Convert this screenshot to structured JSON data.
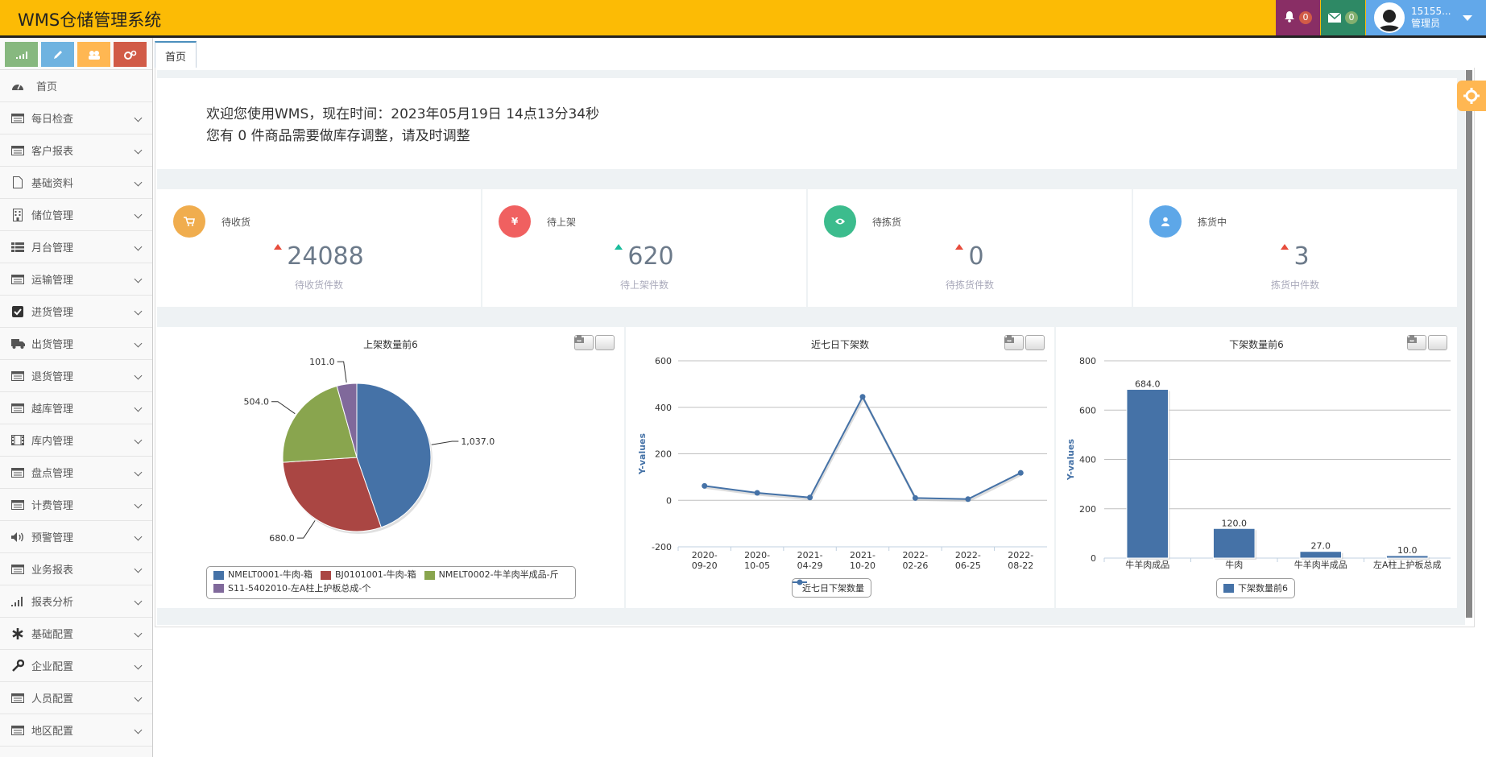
{
  "app": {
    "title": "WMS仓储管理系统"
  },
  "header": {
    "notifications_count": "0",
    "messages_count": "0",
    "user_name": "15155...",
    "user_role": "管理员"
  },
  "sidebar": {
    "home": "首页",
    "items": [
      {
        "label": "每日检查",
        "icon": "list-icon"
      },
      {
        "label": "客户报表",
        "icon": "list-icon"
      },
      {
        "label": "基础资料",
        "icon": "file-icon"
      },
      {
        "label": "储位管理",
        "icon": "building-icon"
      },
      {
        "label": "月台管理",
        "icon": "th-list-icon"
      },
      {
        "label": "运输管理",
        "icon": "list-icon"
      },
      {
        "label": "进货管理",
        "icon": "check-square-icon"
      },
      {
        "label": "出货管理",
        "icon": "truck-icon"
      },
      {
        "label": "退货管理",
        "icon": "list-icon"
      },
      {
        "label": "越库管理",
        "icon": "list-icon"
      },
      {
        "label": "库内管理",
        "icon": "film-icon"
      },
      {
        "label": "盘点管理",
        "icon": "list-icon"
      },
      {
        "label": "计费管理",
        "icon": "list-icon"
      },
      {
        "label": "预警管理",
        "icon": "volume-icon"
      },
      {
        "label": "业务报表",
        "icon": "list-icon"
      },
      {
        "label": "报表分析",
        "icon": "signal-icon"
      },
      {
        "label": "基础配置",
        "icon": "asterisk-icon"
      },
      {
        "label": "企业配置",
        "icon": "wrench-icon"
      },
      {
        "label": "人员配置",
        "icon": "list-icon"
      },
      {
        "label": "地区配置",
        "icon": "list-icon"
      }
    ]
  },
  "tabs": [
    {
      "label": "首页"
    }
  ],
  "welcome": {
    "line1": "欢迎您使用WMS，现在时间：2023年05月19日 14点13分34秒",
    "line2": "您有 0 件商品需要做库存调整，请及时调整"
  },
  "stats": [
    {
      "title": "待收货",
      "value": "24088",
      "sub": "待收货件数",
      "color": "#f0ad4e",
      "trend": "red"
    },
    {
      "title": "待上架",
      "value": "620",
      "sub": "待上架件数",
      "color": "#f06060",
      "trend": "green"
    },
    {
      "title": "待拣货",
      "value": "0",
      "sub": "待拣货件数",
      "color": "#3cbc8d",
      "trend": "red"
    },
    {
      "title": "拣货中",
      "value": "3",
      "sub": "拣货中件数",
      "color": "#5da7e8",
      "trend": "red"
    }
  ],
  "chart_data": [
    {
      "type": "pie",
      "title": "上架数量前6",
      "slices": [
        {
          "name": "NMELT0001-牛肉-箱",
          "value": 1037.0,
          "label": "1,037.0",
          "color": "#4572a7"
        },
        {
          "name": "BJ0101001-牛肉-箱",
          "value": 680.0,
          "label": "680.0",
          "color": "#aa4643"
        },
        {
          "name": "NMELT0002-牛羊肉半成品-斤",
          "value": 504.0,
          "label": "504.0",
          "color": "#89a54e"
        },
        {
          "name": "S11-5402010-左A柱上护板总成-个",
          "value": 101.0,
          "label": "101.0",
          "color": "#80699b"
        }
      ]
    },
    {
      "type": "line",
      "title": "近七日下架数",
      "ylabel": "Y-values",
      "categories": [
        "2020-09-20",
        "2020-10-05",
        "2021-04-29",
        "2021-10-20",
        "2022-02-26",
        "2022-06-25",
        "2022-08-22"
      ],
      "series": [
        {
          "name": "近七日下架数量",
          "values": [
            62,
            32,
            12,
            445,
            10,
            5,
            118
          ],
          "color": "#4572a7"
        }
      ],
      "ylim": [
        -200,
        600
      ],
      "yticks": [
        -200,
        0,
        200,
        400,
        600
      ]
    },
    {
      "type": "bar",
      "title": "下架数量前6",
      "ylabel": "Y-values",
      "categories": [
        "牛羊肉成品",
        "牛肉",
        "牛羊肉半成品",
        "左A柱上护板总成"
      ],
      "series": [
        {
          "name": "下架数量前6",
          "values": [
            684.0,
            120.0,
            27.0,
            10.0
          ],
          "labels": [
            "684.0",
            "120.0",
            "27.0",
            "10.0"
          ],
          "color": "#4572a7"
        }
      ],
      "ylim": [
        0,
        800
      ],
      "yticks": [
        0,
        200,
        400,
        600,
        800
      ]
    }
  ]
}
